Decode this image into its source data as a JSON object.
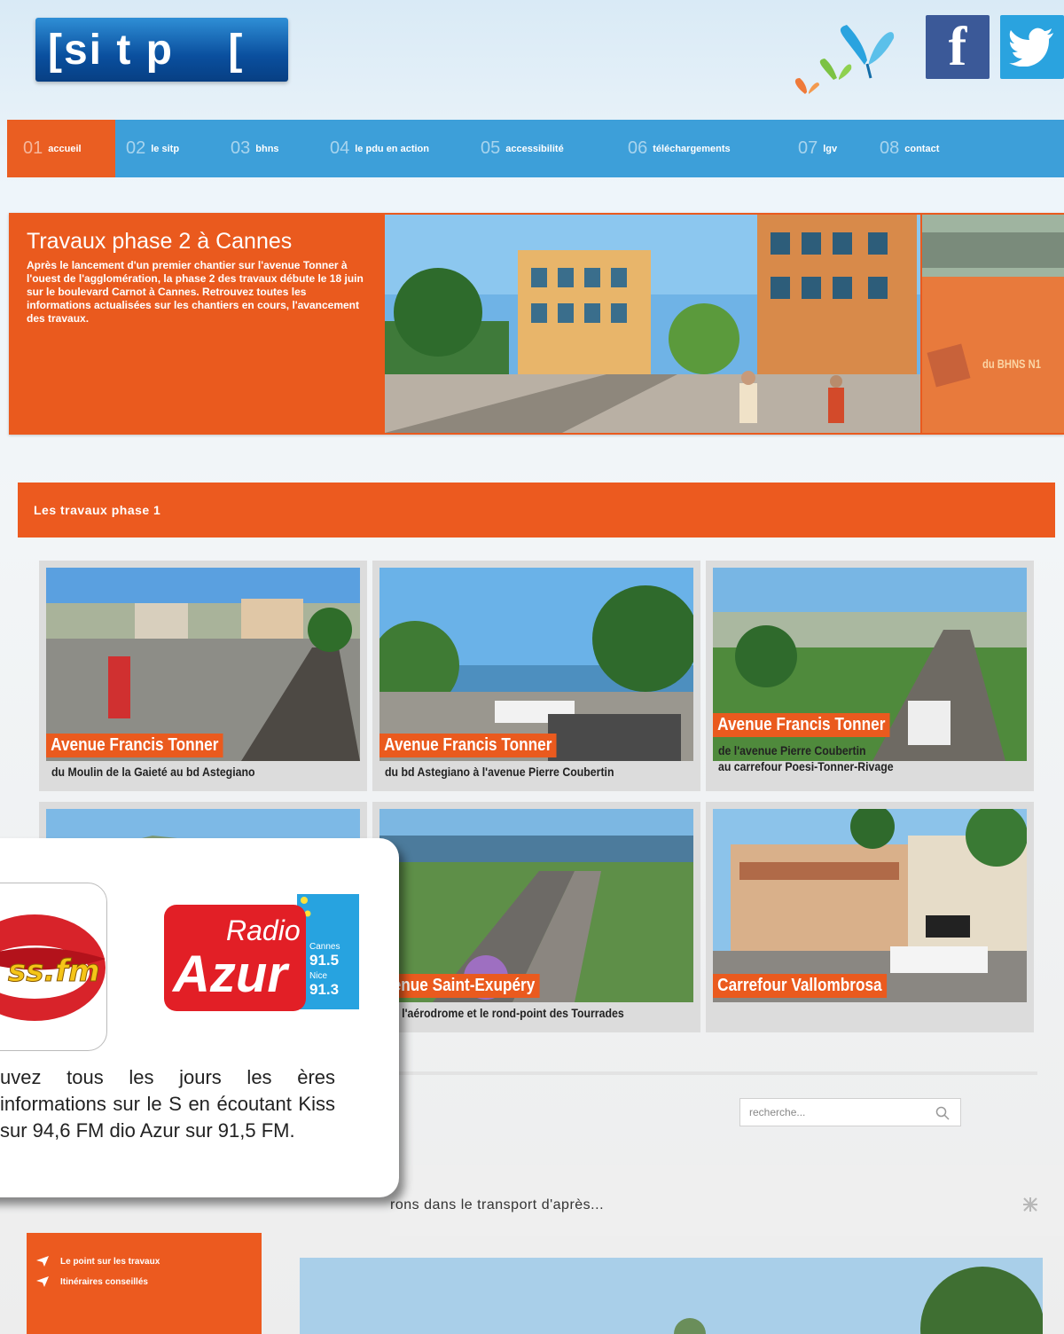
{
  "header": {
    "logo_text": "[si t p    [",
    "facebook_label": "f"
  },
  "nav": {
    "items": [
      {
        "num": "01",
        "label": "accueil"
      },
      {
        "num": "02",
        "label": "le sitp"
      },
      {
        "num": "03",
        "label": "bhns"
      },
      {
        "num": "04",
        "label": "le pdu en action"
      },
      {
        "num": "05",
        "label": "accessibilité"
      },
      {
        "num": "06",
        "label": "téléchargements"
      },
      {
        "num": "07",
        "label": "lgv"
      },
      {
        "num": "08",
        "label": "contact"
      }
    ]
  },
  "hero": {
    "title": "Travaux phase 2 à Cannes",
    "text": "Après le lancement d'un premier chantier sur l'avenue Tonner à l'ouest de l'agglomération, la phase 2 des travaux débute le 18 juin sur le boulevard Carnot à Cannes. Retrouvez toutes les informations actualisées sur les chantiers en cours, l'avancement des travaux.",
    "thumb_caption": "du BHNS N1"
  },
  "section": {
    "title": "Les travaux phase 1"
  },
  "cards": [
    {
      "title": "Avenue Francis Tonner",
      "subtitle": "du Moulin de la Gaieté au bd Astegiano"
    },
    {
      "title": "Avenue Francis Tonner",
      "subtitle": "du bd Astegiano à l'avenue Pierre Coubertin"
    },
    {
      "title": "Avenue Francis Tonner",
      "subtitle": "de l'avenue Pierre Coubertin",
      "subtitle2": "au carrefour Poesi-Tonner-Rivage"
    },
    {
      "title": "",
      "subtitle": ""
    },
    {
      "title": "venue Saint-Exupéry",
      "subtitle": "tre l'aérodrome et le rond-point des Tourrades"
    },
    {
      "title": "Carrefour Vallombrosa",
      "subtitle": ""
    }
  ],
  "search": {
    "placeholder": "recherche..."
  },
  "tagline": "rons dans le transport d'après...",
  "sidebar": {
    "links": [
      "Le point sur les travaux",
      "Itinéraires conseillés"
    ]
  },
  "popup": {
    "azur_title_1": "Radio",
    "azur_title_2": "Azur",
    "azur_freq_1_city": "Cannes",
    "azur_freq_1": "91.5",
    "azur_freq_2_city": "Nice",
    "azur_freq_2": "91.3",
    "kiss_text": "ss.fm",
    "text": "uvez tous les jours les ères informations sur le S en écoutant Kiss sur 94,6 FM dio Azur sur 91,5 FM."
  },
  "colors": {
    "orange": "#ea5a1e",
    "nav_blue": "#3d9fd9",
    "logo_blue": "#0a4f9e"
  }
}
